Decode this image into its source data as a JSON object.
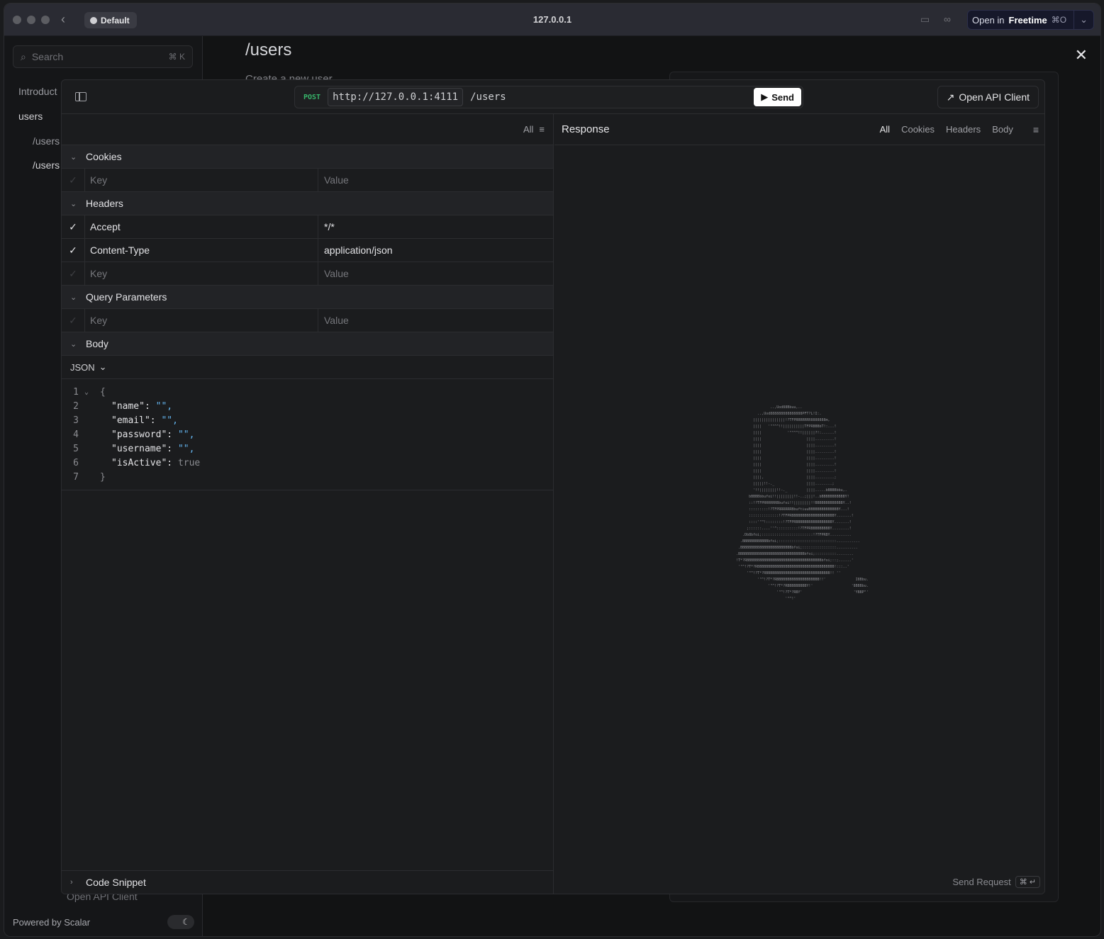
{
  "browser": {
    "profile": "Default",
    "url": "127.0.0.1",
    "open_in_label": "Open in",
    "open_in_app": "Freetime",
    "open_in_shortcut": "⌘O"
  },
  "background": {
    "search_placeholder": "Search",
    "search_shortcut": "⌘ K",
    "nav": [
      "Introduct",
      "users",
      "/users",
      "/users"
    ],
    "page_title": "/users",
    "page_subtitle": "Create a new user",
    "footer_link": "Open API Client",
    "powered_by": "Powered by Scalar"
  },
  "request": {
    "method": "POST",
    "server": "http://127.0.0.1:4111",
    "path": "/users",
    "send_label": "Send",
    "open_api_client_label": "Open API Client",
    "filter_label": "All",
    "sections": {
      "cookies": "Cookies",
      "headers": "Headers",
      "query": "Query Parameters",
      "body": "Body",
      "code_snippet": "Code Snippet"
    },
    "key_placeholder": "Key",
    "value_placeholder": "Value",
    "headers": [
      {
        "key": "Accept",
        "value": "*/*"
      },
      {
        "key": "Content-Type",
        "value": "application/json"
      }
    ],
    "body_type": "JSON",
    "body_lines": [
      {
        "n": "1",
        "text": "{"
      },
      {
        "n": "2",
        "key": "\"name\"",
        "val": "\"\","
      },
      {
        "n": "3",
        "key": "\"email\"",
        "val": "\"\","
      },
      {
        "n": "4",
        "key": "\"password\"",
        "val": "\"\","
      },
      {
        "n": "5",
        "key": "\"username\"",
        "val": "\"\","
      },
      {
        "n": "6",
        "key": "\"isActive\"",
        "val": "true"
      },
      {
        "n": "7",
        "text": "}"
      }
    ]
  },
  "response": {
    "title": "Response",
    "tabs": [
      "All",
      "Cookies",
      "Headers",
      "Body"
    ],
    "send_request_label": "Send Request",
    "send_request_shortcut": "⌘ ↵"
  }
}
